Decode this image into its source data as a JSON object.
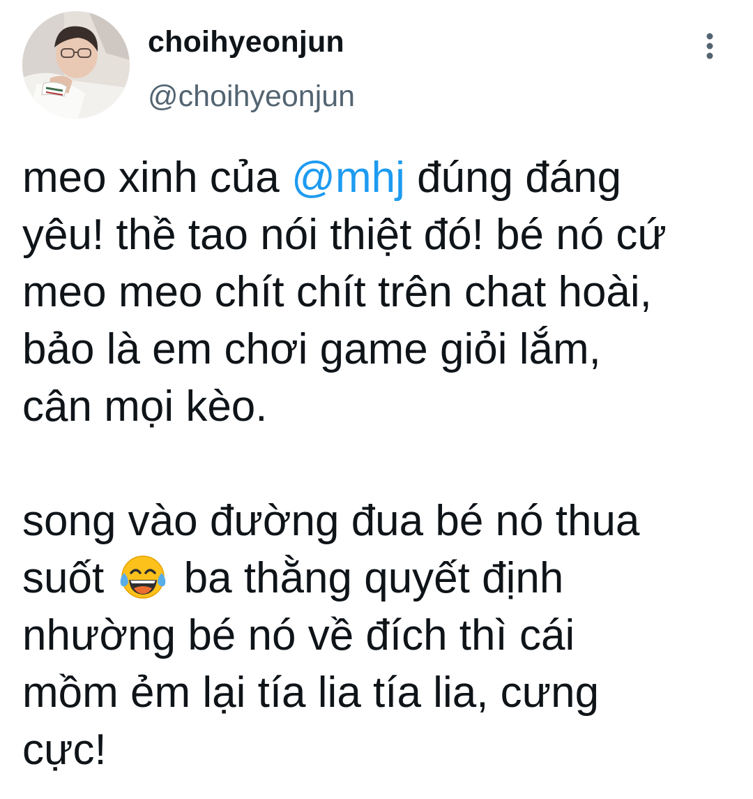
{
  "author": {
    "display_name": "choihyeonjun",
    "handle": "@choihyeonjun",
    "avatar_icon": "profile-photo"
  },
  "header": {
    "more_icon": "vertical-ellipsis-icon"
  },
  "tweet": {
    "part1": "meo xinh của ",
    "mention": "@mhj",
    "part2": " đúng đáng\nyêu! thề tao nói thiệt đó! bé nó cứ\nmeo meo chít chít trên chat hoài,\nbảo là em chơi game giỏi lắm,\ncân mọi kèo.\n\nsong vào đường đua bé nó thua\nsuốt ",
    "emoji": "😂",
    "part3": " ba thằng quyết định\nnhường bé nó về đích thì cái\nmồm ẻm lại tía lia tía lia, cưng\ncực!"
  },
  "colors": {
    "mention": "#1d9bf0",
    "handle": "#536471",
    "text": "#0f1419",
    "background": "#ffffff"
  }
}
